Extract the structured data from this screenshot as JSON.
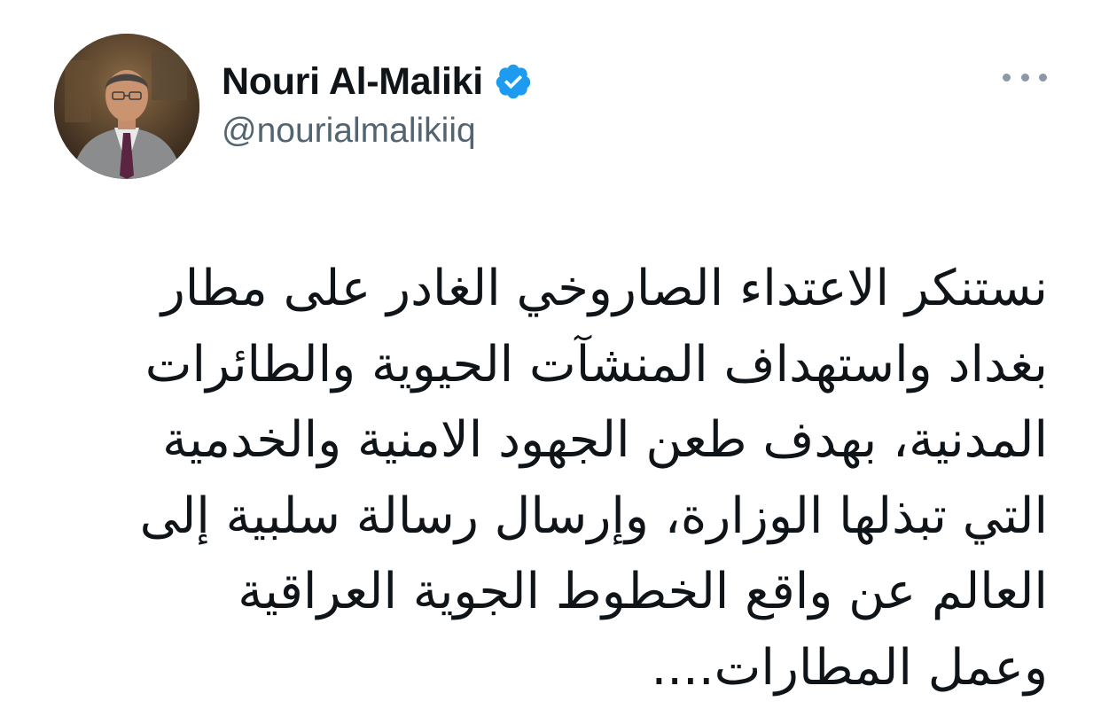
{
  "author": {
    "display_name": "Nouri Al-Maliki",
    "handle": "@nourialmalikiiq",
    "verified": true,
    "avatar_icon": "profile-photo"
  },
  "menu": {
    "icon": "more-horizontal-icon"
  },
  "tweet": {
    "lines": [
      "نستنكر الاعتداء الصاروخي الغادر على مطار",
      "بغداد واستهداف المنشآت الحيوية والطائرات",
      "المدنية، بهدف طعن الجهود الامنية والخدمية",
      "التي تبذلها الوزارة، وإرسال رسالة سلبية إلى",
      "العالم عن واقع الخطوط الجوية العراقية",
      "وعمل المطارات...."
    ]
  },
  "colors": {
    "text": "#0f1419",
    "secondary": "#536471",
    "verified": "#1d9bf0",
    "dots": "#8b98a5"
  }
}
